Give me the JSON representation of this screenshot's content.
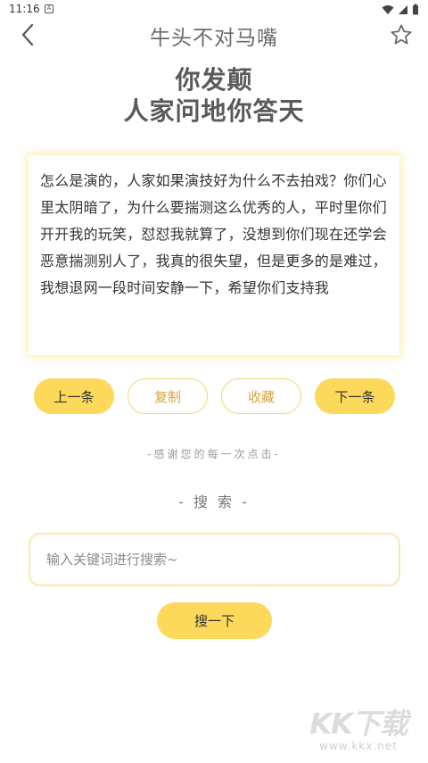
{
  "status_bar": {
    "time": "11:16",
    "notification_glyph": "A"
  },
  "header": {
    "title": "牛头不对马嘴",
    "back_icon": "chevron-left-icon",
    "favorite_icon": "star-outline-icon"
  },
  "headline": {
    "line1": "你发颠",
    "line2": "人家问地你答天"
  },
  "content": {
    "text": "怎么是演的，人家如果演技好为什么不去拍戏？你们心里太阴暗了，为什么要揣测这么优秀的人，平时里你们开开我的玩笑，怼怼我就算了，没想到你们现在还学会恶意揣测别人了，我真的很失望，但是更多的是难过，我想退网一段时间安静一下，希望你们支持我"
  },
  "actions": {
    "prev_label": "上一条",
    "copy_label": "复制",
    "collect_label": "收藏",
    "next_label": "下一条"
  },
  "thanks_text": "-感谢您的每一次点击-",
  "search": {
    "heading": "- 搜 索 -",
    "placeholder": "输入关键词进行搜索~",
    "value": "",
    "button_label": "搜一下"
  },
  "watermark": {
    "logo": "KK下载",
    "url": "www.kkx.net"
  },
  "colors": {
    "accent": "#fcd95a",
    "outline": "#f3d572",
    "outline_text": "#d9a43a",
    "card_glow": "#fcdc64"
  }
}
